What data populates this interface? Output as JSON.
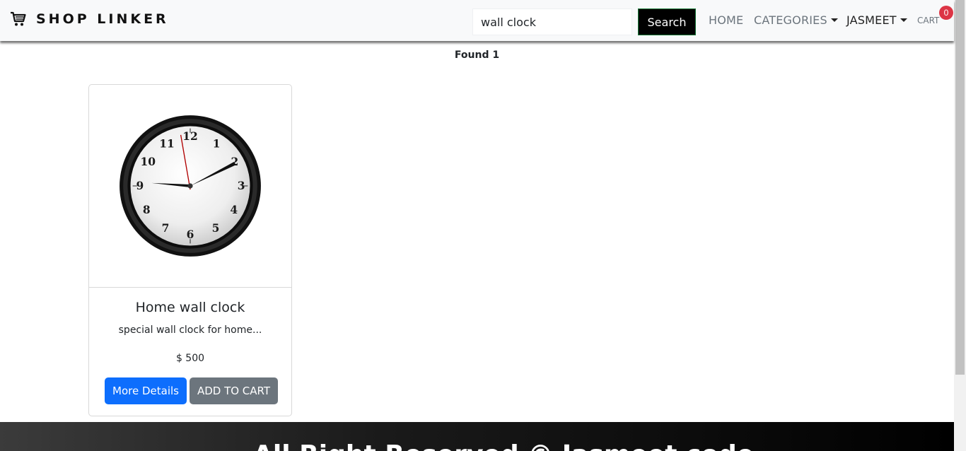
{
  "navbar": {
    "brand": "SHOP LINKER",
    "brand_icon": "shopping-cart-icon",
    "search_value": "wall clock",
    "search_button": "Search",
    "links": {
      "home": "HOME",
      "categories": "CATEGORIES",
      "user": "JASMEET",
      "cart": "CART"
    },
    "cart_count": "0"
  },
  "results": {
    "found_text": "Found 1"
  },
  "products": [
    {
      "name": "Home wall clock",
      "description": "special wall clock for home...",
      "price": "$ 500",
      "details_button": "More Details",
      "cart_button": "ADD TO CART"
    }
  ],
  "footer": {
    "text": "All Right Reserved © Jasmeet code"
  },
  "colors": {
    "primary": "#0d6efd",
    "secondary": "#6c757d",
    "badge": "#dc3545",
    "navbar_bg": "#f8f9fa"
  }
}
